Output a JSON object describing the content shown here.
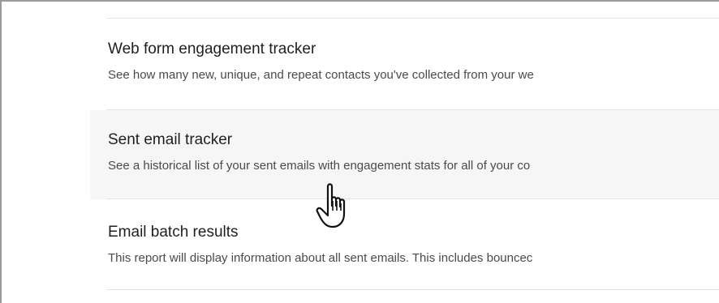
{
  "reports": [
    {
      "title": "Web form engagement tracker",
      "description": "See how many new, unique, and repeat contacts you've collected from your we"
    },
    {
      "title": "Sent email tracker",
      "description": "See a historical list of your sent emails with engagement stats for all of your co"
    },
    {
      "title": "Email batch results",
      "description": "This report will display information about all sent emails. This includes bouncec"
    }
  ],
  "cursor_icon": "hand-pointer-icon"
}
